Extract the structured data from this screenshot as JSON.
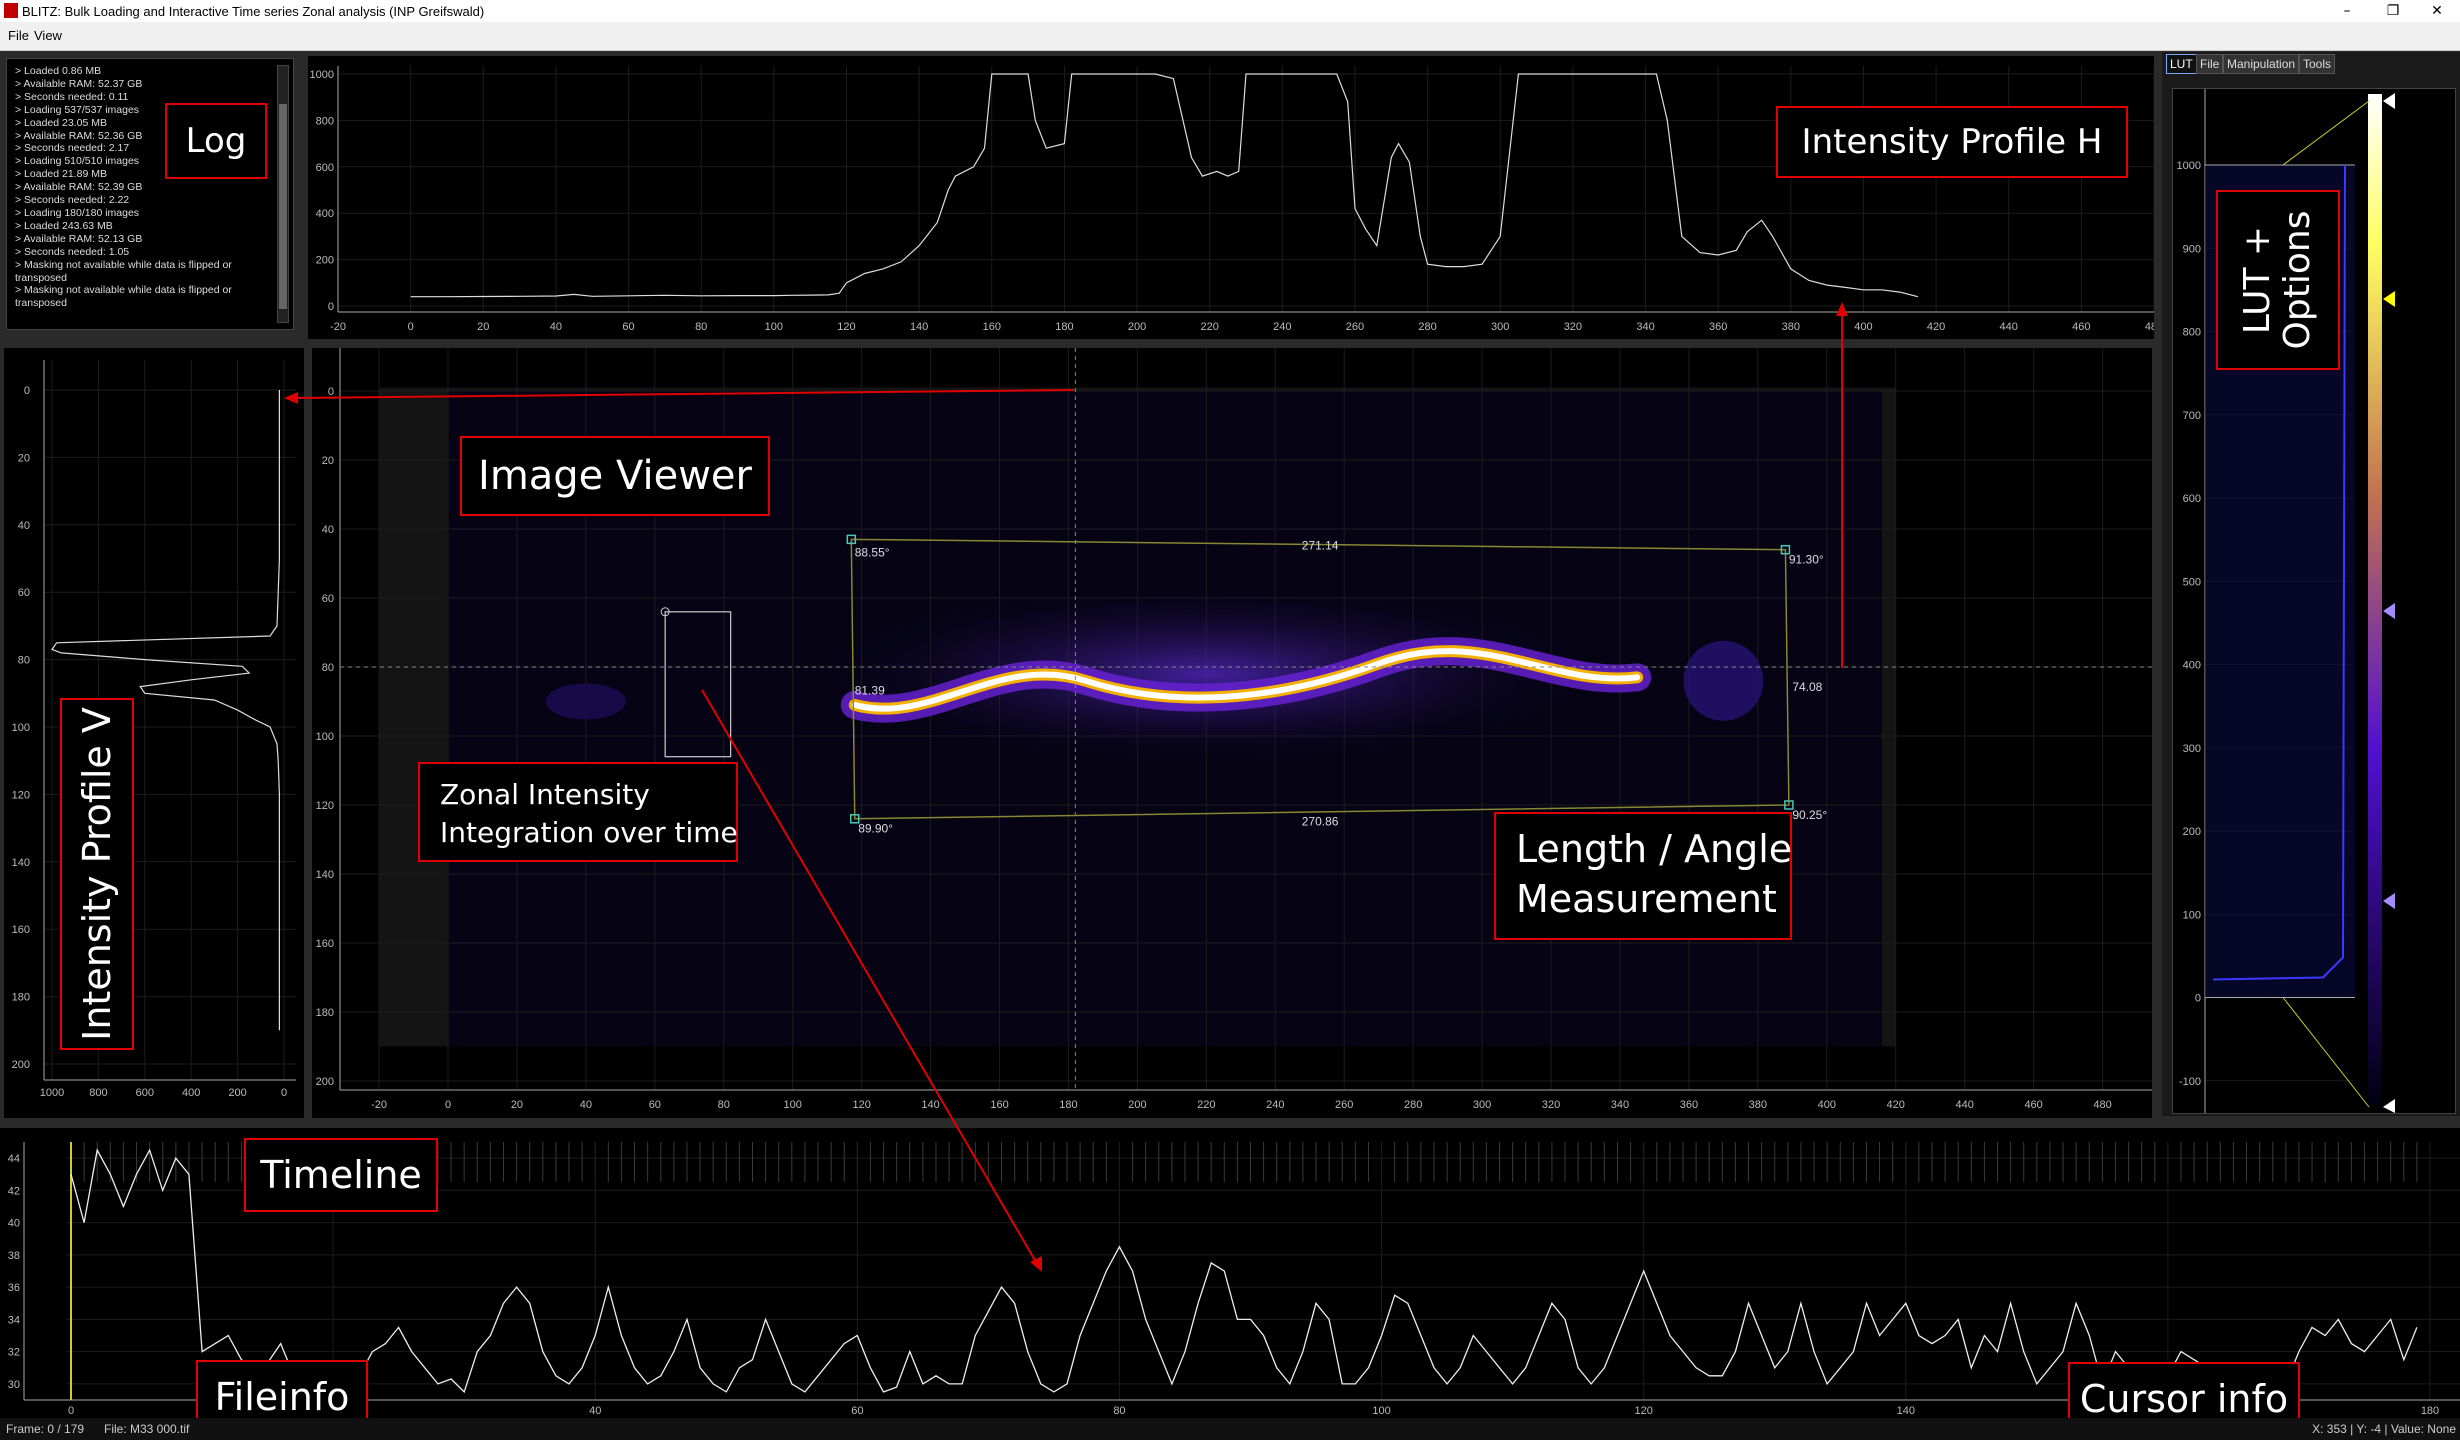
{
  "window": {
    "title": "BLITZ: Bulk Loading and Interactive Time series Zonal analysis (INP Greifswald)",
    "min_icon": "minimize-icon",
    "max_icon": "restore-icon",
    "close_icon": "close-icon"
  },
  "menu": [
    "File",
    "View"
  ],
  "log": {
    "lines": [
      "> Loaded 0.86 MB",
      "> Available RAM: 52.37 GB",
      "> Seconds needed: 0.11",
      "> Loading 537/537 images",
      "> Loaded 23.05 MB",
      "> Available RAM: 52.36 GB",
      "> Seconds needed: 2.17",
      "> Loading 510/510 images",
      "> Loaded 21.89 MB",
      "> Available RAM: 52.39 GB",
      "> Seconds needed: 2.22",
      "> Loading 180/180 images",
      "> Loaded 243.63 MB",
      "> Available RAM: 52.13 GB",
      "> Seconds needed: 1.05",
      "> Masking not available while data is flipped or",
      "transposed",
      "> Masking not available while data is flipped or",
      "transposed"
    ]
  },
  "tabs": [
    "LUT",
    "File",
    "Manipulation",
    "Tools"
  ],
  "annotations": {
    "log": "Log",
    "profile_h": "Intensity Profile H",
    "lut": "LUT + Options",
    "image_viewer": "Image Viewer",
    "profile_v": "Intensity Profile V",
    "zonal_line1": "Zonal Intensity",
    "zonal_line2": "Integration over time",
    "length_line1": "Length / Angle",
    "length_line2": "Measurement",
    "timeline": "Timeline",
    "fileinfo": "Fileinfo",
    "cursor": "Cursor info"
  },
  "measurement": {
    "top_length": "271.14",
    "bottom_length": "270.86",
    "right_length": "74.08",
    "left_length": "81.39",
    "angle_tl": "88.55°",
    "angle_tr": "91.30°",
    "angle_bl": "89.90°",
    "angle_br": "90.25°"
  },
  "status": {
    "frame": "Frame: 0 / 179",
    "file": "File: M33 000.tif",
    "cursor": "X: 353 | Y: -4 | Value: None"
  },
  "colors": {
    "annotation_border": "#e00000",
    "accent_tab": "#77aaff",
    "plot_line": "#ffffff",
    "roi_box": "#888833"
  },
  "chart_data": [
    {
      "type": "line",
      "name": "intensity-profile-h",
      "x": [
        0,
        10,
        20,
        30,
        40,
        45,
        50,
        60,
        70,
        80,
        90,
        100,
        105,
        110,
        115,
        118,
        120,
        125,
        130,
        135,
        140,
        145,
        148,
        150,
        155,
        158,
        160,
        163,
        166,
        170,
        172,
        175,
        180,
        182,
        185,
        188,
        190,
        192,
        195,
        200,
        205,
        210,
        215,
        218,
        222,
        225,
        228,
        230,
        235,
        240,
        245,
        250,
        255,
        258,
        260,
        263,
        266,
        270,
        272,
        275,
        278,
        280,
        285,
        290,
        295,
        300,
        305,
        310,
        315,
        320,
        325,
        330,
        335,
        340,
        343,
        346,
        350,
        355,
        360,
        365,
        368,
        372,
        375,
        380,
        385,
        390,
        395,
        400,
        405,
        410,
        415
      ],
      "y": [
        40,
        40,
        41,
        42,
        43,
        50,
        42,
        44,
        46,
        44,
        45,
        45,
        46,
        47,
        48,
        55,
        100,
        140,
        160,
        190,
        260,
        360,
        500,
        560,
        600,
        680,
        1000,
        1000,
        1000,
        1000,
        800,
        680,
        700,
        1000,
        1000,
        1000,
        1000,
        1000,
        1000,
        1000,
        1000,
        980,
        640,
        560,
        580,
        560,
        580,
        1000,
        1000,
        1000,
        1000,
        1000,
        1000,
        880,
        420,
        330,
        260,
        640,
        700,
        620,
        300,
        180,
        170,
        170,
        180,
        300,
        1000,
        1000,
        1000,
        1000,
        1000,
        1000,
        1000,
        1000,
        1000,
        800,
        300,
        230,
        220,
        240,
        320,
        370,
        300,
        160,
        110,
        90,
        80,
        70,
        70,
        60,
        40
      ],
      "xlim": [
        -20,
        480
      ],
      "ylim": [
        0,
        1000
      ],
      "xticks": [
        -20,
        0,
        20,
        40,
        60,
        80,
        100,
        120,
        140,
        160,
        180,
        200,
        220,
        240,
        260,
        280,
        300,
        320,
        340,
        360,
        380,
        400,
        420,
        440,
        460,
        480
      ],
      "yticks": [
        0,
        200,
        400,
        600,
        800,
        1000
      ]
    },
    {
      "type": "line",
      "name": "intensity-profile-v",
      "y": [
        0,
        10,
        20,
        30,
        40,
        50,
        60,
        70,
        73,
        75,
        77,
        78,
        80,
        82,
        84,
        86,
        88,
        90,
        92,
        95,
        98,
        100,
        105,
        110,
        120,
        140,
        160,
        180,
        190
      ],
      "x": [
        20,
        20,
        20,
        20,
        20,
        20,
        25,
        30,
        60,
        980,
        1000,
        960,
        600,
        180,
        150,
        400,
        620,
        600,
        300,
        200,
        120,
        60,
        30,
        25,
        20,
        20,
        20,
        20,
        20
      ],
      "xlim": [
        1000,
        0
      ],
      "ylim": [
        0,
        200
      ],
      "xticks": [
        1000,
        800,
        600,
        400,
        200,
        0
      ],
      "yticks": [
        0,
        20,
        40,
        60,
        80,
        100,
        120,
        140,
        160,
        180,
        200
      ]
    },
    {
      "type": "line",
      "name": "timeline",
      "x": [
        0,
        1,
        2,
        3,
        4,
        5,
        6,
        7,
        8,
        9,
        10,
        11,
        12,
        13,
        14,
        15,
        16,
        17,
        18,
        19,
        20,
        21,
        22,
        23,
        24,
        25,
        26,
        27,
        28,
        29,
        30,
        31,
        32,
        33,
        34,
        35,
        36,
        37,
        38,
        39,
        40,
        41,
        42,
        43,
        44,
        45,
        46,
        47,
        48,
        49,
        50,
        51,
        52,
        53,
        54,
        55,
        56,
        57,
        58,
        59,
        60,
        61,
        62,
        63,
        64,
        65,
        66,
        67,
        68,
        69,
        70,
        71,
        72,
        73,
        74,
        75,
        76,
        77,
        78,
        79,
        80,
        81,
        82,
        83,
        84,
        85,
        86,
        87,
        88,
        89,
        90,
        91,
        92,
        93,
        94,
        95,
        96,
        97,
        98,
        99,
        100,
        101,
        102,
        103,
        104,
        105,
        106,
        107,
        108,
        109,
        110,
        111,
        112,
        113,
        114,
        115,
        116,
        117,
        118,
        119,
        120,
        121,
        122,
        123,
        124,
        125,
        126,
        127,
        128,
        129,
        130,
        131,
        132,
        133,
        134,
        135,
        136,
        137,
        138,
        139,
        140,
        141,
        142,
        143,
        144,
        145,
        146,
        147,
        148,
        149,
        150,
        151,
        152,
        153,
        154,
        155,
        156,
        157,
        158,
        159,
        160,
        161,
        162,
        163,
        164,
        165,
        166,
        167,
        168,
        169,
        170,
        171,
        172,
        173,
        174,
        175,
        176,
        177,
        178,
        179
      ],
      "y": [
        43,
        40,
        44.5,
        43,
        41,
        43,
        44.5,
        42,
        44,
        43,
        32,
        32.5,
        33,
        31.5,
        31,
        31.3,
        32.5,
        30.5,
        30.5,
        29.5,
        29.5,
        31,
        30.5,
        32,
        32.5,
        33.5,
        32,
        31,
        30,
        30.3,
        29.5,
        32,
        33,
        35,
        36,
        35,
        32,
        30.5,
        30,
        31,
        33,
        36,
        33,
        31,
        30,
        30.5,
        32,
        34,
        31,
        30,
        29.5,
        31,
        31.5,
        34,
        32,
        30,
        29.5,
        30.5,
        31.5,
        32.5,
        33,
        31,
        29.5,
        29.8,
        32,
        30,
        30.5,
        30,
        30,
        33,
        34.5,
        36,
        35,
        32,
        30,
        29.5,
        30,
        33,
        35,
        37,
        38.5,
        37,
        34,
        32,
        30,
        32,
        35,
        37.5,
        37,
        34,
        34,
        33,
        31,
        30,
        32,
        35,
        34,
        30,
        30,
        31,
        33,
        35.5,
        35,
        33,
        31,
        30,
        31,
        33,
        32,
        31,
        30,
        31,
        33,
        35,
        34,
        31,
        30,
        31,
        33,
        35,
        37,
        35,
        33,
        32,
        31,
        30.5,
        30.5,
        32,
        35,
        33,
        31,
        32,
        35,
        32,
        30,
        31,
        32,
        35,
        33,
        34,
        35,
        33,
        32.5,
        33,
        34,
        31,
        33,
        32,
        35,
        32,
        30,
        31,
        32,
        35,
        33,
        30,
        32,
        31,
        30.5,
        30,
        30.5,
        32,
        31.5,
        31,
        30.5,
        30.5,
        30,
        31,
        30,
        30,
        32,
        33.5,
        33,
        34,
        32.5,
        32,
        33,
        34,
        31.5,
        33.5,
        33
      ],
      "xlim": [
        -5,
        180
      ],
      "ylim": [
        29,
        45
      ],
      "xticks": [
        0,
        20,
        40,
        60,
        80,
        100,
        120,
        140,
        160,
        180
      ],
      "yticks": [
        30,
        32,
        34,
        36,
        38,
        40,
        42,
        44
      ]
    }
  ],
  "image_axes": {
    "xticks": [
      -20,
      0,
      20,
      40,
      60,
      80,
      100,
      120,
      140,
      160,
      180,
      200,
      220,
      240,
      260,
      280,
      300,
      320,
      340,
      360,
      380,
      400,
      420,
      440,
      460,
      480
    ],
    "yticks": [
      0,
      20,
      40,
      60,
      80,
      100,
      120,
      140,
      160,
      180,
      200
    ]
  },
  "lut_axis": {
    "ticks": [
      1000,
      900,
      800,
      700,
      600,
      500,
      400,
      300,
      200,
      100,
      0,
      -100
    ]
  }
}
